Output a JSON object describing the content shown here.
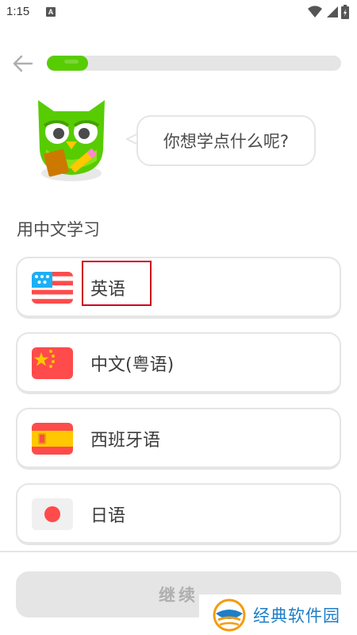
{
  "status_bar": {
    "time": "1:15",
    "notification_badge": "A"
  },
  "progress": {
    "fraction": 0.14
  },
  "speech_bubble": {
    "text": "你想学点什么呢?"
  },
  "section_title": "用中文学习",
  "options": [
    {
      "label": "英语",
      "flag": "us-flag",
      "selected_highlight": true
    },
    {
      "label": "中文(粤语)",
      "flag": "china-flag",
      "selected_highlight": false
    },
    {
      "label": "西班牙语",
      "flag": "spain-flag",
      "selected_highlight": false
    },
    {
      "label": "日语",
      "flag": "japan-flag",
      "selected_highlight": false
    }
  ],
  "continue_button": {
    "label": "继续",
    "enabled": false
  },
  "watermark": {
    "text": "经典软件园"
  },
  "colors": {
    "accent_green": "#58cc02",
    "border_gray": "#e5e5e5",
    "disabled_text": "#afafaf",
    "highlight_red": "#d0021b",
    "watermark_blue": "#1e7ec8"
  }
}
